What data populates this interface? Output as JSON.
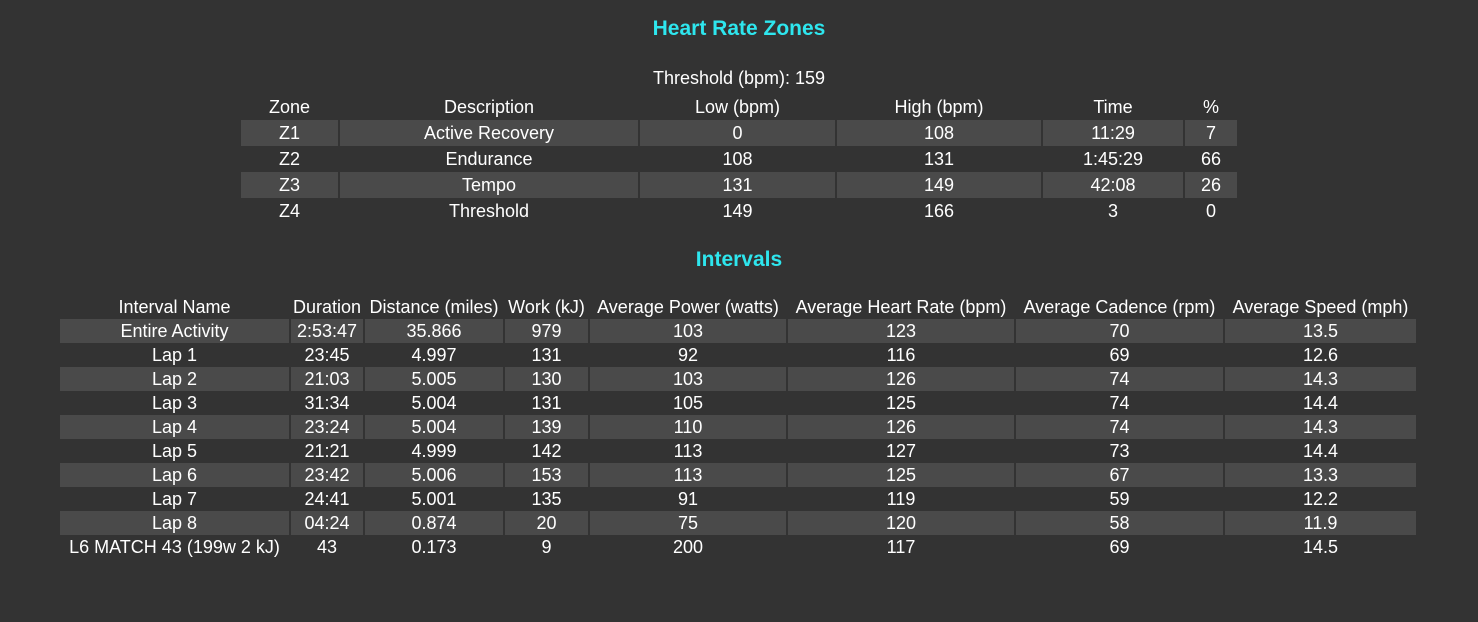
{
  "heart_rate_zones": {
    "title": "Heart Rate Zones",
    "threshold_label": "Threshold (bpm): 159",
    "headers": [
      "Zone",
      "Description",
      "Low (bpm)",
      "High (bpm)",
      "Time",
      "%"
    ],
    "rows": [
      [
        "Z1",
        "Active Recovery",
        "0",
        "108",
        "11:29",
        "7"
      ],
      [
        "Z2",
        "Endurance",
        "108",
        "131",
        "1:45:29",
        "66"
      ],
      [
        "Z3",
        "Tempo",
        "131",
        "149",
        "42:08",
        "26"
      ],
      [
        "Z4",
        "Threshold",
        "149",
        "166",
        "3",
        "0"
      ]
    ]
  },
  "intervals": {
    "title": "Intervals",
    "headers": [
      "Interval Name",
      "Duration",
      "Distance (miles)",
      "Work (kJ)",
      "Average Power (watts)",
      "Average Heart Rate (bpm)",
      "Average Cadence (rpm)",
      "Average Speed (mph)"
    ],
    "rows": [
      [
        "Entire Activity",
        "2:53:47",
        "35.866",
        "979",
        "103",
        "123",
        "70",
        "13.5"
      ],
      [
        "Lap 1",
        "23:45",
        "4.997",
        "131",
        "92",
        "116",
        "69",
        "12.6"
      ],
      [
        "Lap 2",
        "21:03",
        "5.005",
        "130",
        "103",
        "126",
        "74",
        "14.3"
      ],
      [
        "Lap 3",
        "31:34",
        "5.004",
        "131",
        "105",
        "125",
        "74",
        "14.4"
      ],
      [
        "Lap 4",
        "23:24",
        "5.004",
        "139",
        "110",
        "126",
        "74",
        "14.3"
      ],
      [
        "Lap 5",
        "21:21",
        "4.999",
        "142",
        "113",
        "127",
        "73",
        "14.4"
      ],
      [
        "Lap 6",
        "23:42",
        "5.006",
        "153",
        "113",
        "125",
        "67",
        "13.3"
      ],
      [
        "Lap 7",
        "24:41",
        "5.001",
        "135",
        "91",
        "119",
        "59",
        "12.2"
      ],
      [
        "Lap 8",
        "04:24",
        "0.874",
        "20",
        "75",
        "120",
        "58",
        "11.9"
      ],
      [
        "L6 MATCH 43 (199w 2 kJ)",
        "43",
        "0.173",
        "9",
        "200",
        "117",
        "69",
        "14.5"
      ]
    ]
  },
  "colors": {
    "background": "#333333",
    "row_shade": "#4a4a4a",
    "title_accent": "#2ee6ee",
    "text": "#ffffff"
  }
}
